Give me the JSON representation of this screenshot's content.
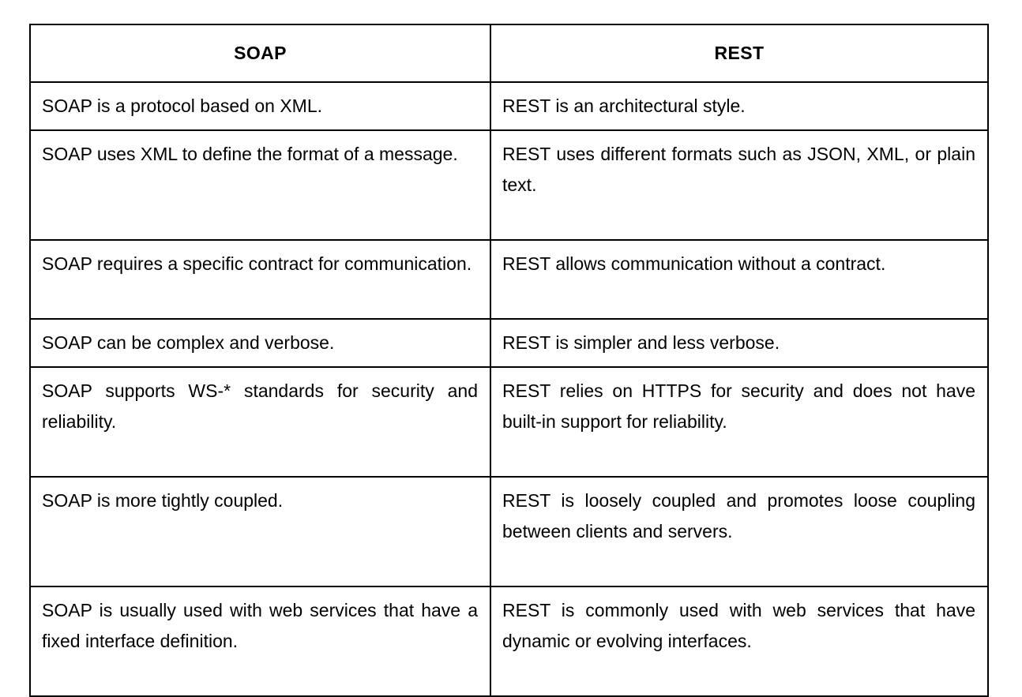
{
  "page": {
    "background_color": "#ffffff",
    "text_color": "#000000",
    "border_color": "#000000"
  },
  "table": {
    "name": "soap-vs-rest-comparison-table",
    "columns": [
      {
        "key": "soap",
        "header": "SOAP"
      },
      {
        "key": "rest",
        "header": "REST"
      }
    ],
    "rows": [
      {
        "soap": "SOAP is a protocol based on XML.",
        "rest": "REST is an architectural style."
      },
      {
        "soap": "SOAP uses XML to define the format of a message.",
        "rest": "REST uses different formats such as JSON, XML, or plain text."
      },
      {
        "soap": "SOAP requires a specific contract for communication.",
        "rest": "REST allows communication without a contract."
      },
      {
        "soap": "SOAP can be complex and verbose.",
        "rest": "REST is simpler and less verbose."
      },
      {
        "soap": "SOAP supports WS-* standards for security and reliability.",
        "rest": "REST relies on HTTPS for security and does not have built-in support for reliability."
      },
      {
        "soap": "SOAP is more tightly coupled.",
        "rest": "REST is loosely coupled and promotes loose coupling between clients and servers."
      },
      {
        "soap": "SOAP is usually used with web services that have a fixed interface definition.",
        "rest": "REST is commonly used with web services that have dynamic or evolving interfaces."
      }
    ]
  }
}
